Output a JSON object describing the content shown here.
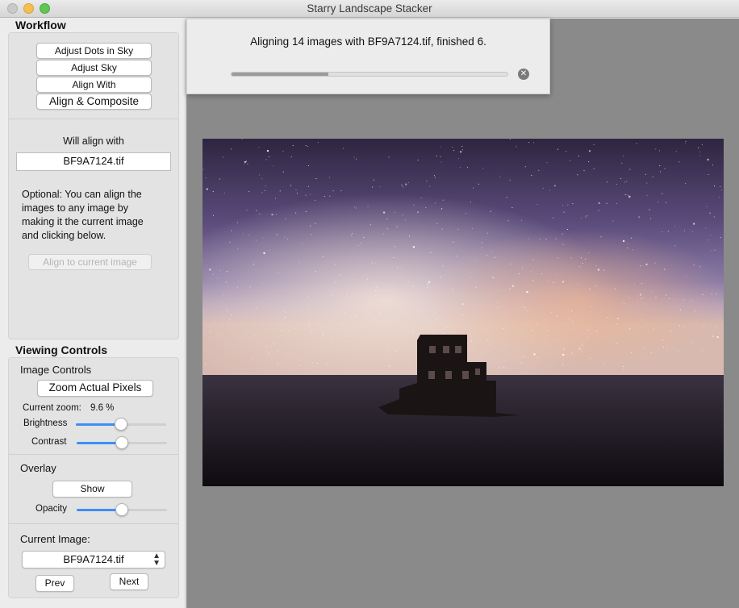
{
  "window": {
    "title": "Starry Landscape Stacker"
  },
  "workflow": {
    "title": "Workflow",
    "buttons": [
      "Adjust Dots in Sky",
      "Adjust Sky",
      "Align With",
      "Align & Composite"
    ],
    "will_align_label": "Will align with",
    "align_target": "BF9A7124.tif",
    "optional_text": [
      "Optional: You can align the",
      "images to any image by",
      "making it the current image",
      "and clicking below."
    ],
    "align_current_button": "Align to current image"
  },
  "viewing": {
    "title": "Viewing Controls",
    "image_controls_label": "Image Controls",
    "zoom_button": "Zoom Actual Pixels",
    "zoom_label": "Current zoom:",
    "zoom_value": "9.6 %",
    "brightness_label": "Brightness",
    "brightness_value": 0.5,
    "contrast_label": "Contrast",
    "contrast_value": 0.5
  },
  "overlay": {
    "label": "Overlay",
    "show_button": "Show",
    "opacity_label": "Opacity",
    "opacity_value": 0.5
  },
  "current_image": {
    "label": "Current Image:",
    "selected": "BF9A7124.tif",
    "prev_button": "Prev",
    "next_button": "Next"
  },
  "progress": {
    "message": "Aligning 14 images with BF9A7124.tif, finished 6.",
    "fraction": 0.35
  },
  "colors": {
    "accent": "#3b8ff7",
    "canvas_bg": "#8a8a8a"
  }
}
